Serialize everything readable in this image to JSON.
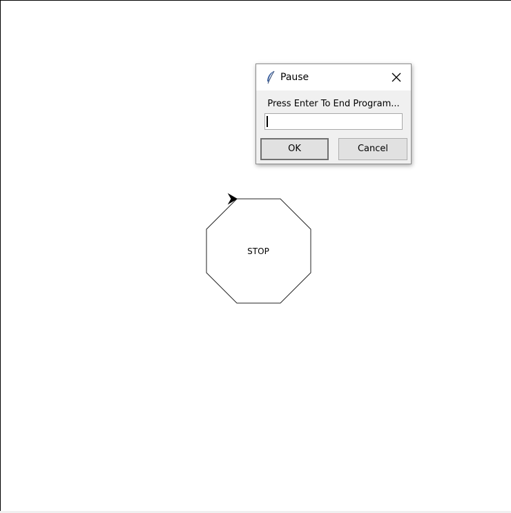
{
  "dialog": {
    "title": "Pause",
    "prompt": "Press Enter To End Program...",
    "entry_value": "",
    "ok_label": "OK",
    "cancel_label": "Cancel",
    "title_icon": "feather-icon",
    "close_icon": "close-icon"
  },
  "canvas": {
    "shape_label": "STOP",
    "shape": "octagon",
    "turtle_icon": "arrow-cursor-icon"
  }
}
